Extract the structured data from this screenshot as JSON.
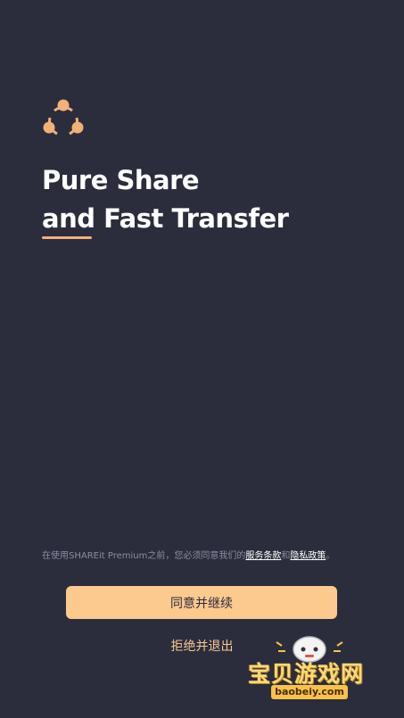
{
  "app": {
    "logo_icon": "shareit-logo-icon",
    "accent_color": "#f2b07a",
    "background_color": "#2b2d3c"
  },
  "hero": {
    "line1": "Pure Share",
    "line2": "and Fast Transfer"
  },
  "consent": {
    "prefix": "在使用SHAREit Premium之前，您必须同意我们的",
    "terms_link": "服务条款",
    "conjunction": "和",
    "privacy_link": "隐私政策",
    "suffix": "。"
  },
  "actions": {
    "agree_label": "同意并继续",
    "decline_label": "拒绝并退出"
  },
  "watermark": {
    "title": "宝贝游戏网",
    "url": "baobeiy.com"
  }
}
